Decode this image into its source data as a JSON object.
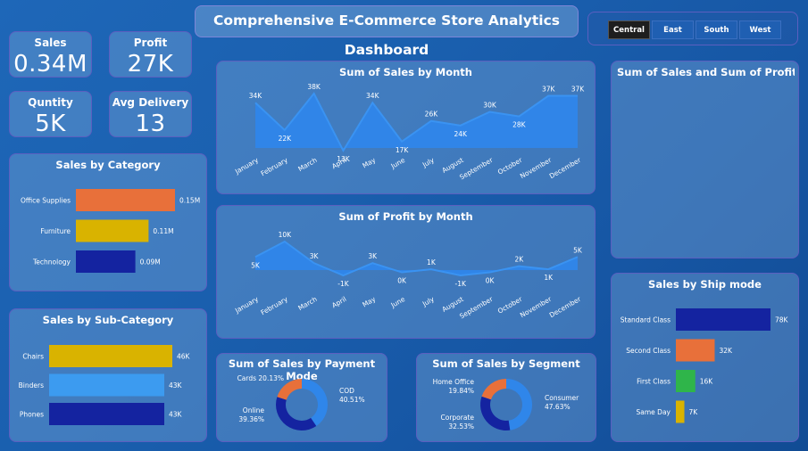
{
  "title": "Comprehensive E-Commerce Store Analytics Dashboard",
  "regions": [
    "Central",
    "East",
    "South",
    "West"
  ],
  "active_region": "Central",
  "kpis": {
    "sales": {
      "label": "Sales",
      "value": "0.34M"
    },
    "profit": {
      "label": "Profit",
      "value": "27K"
    },
    "quantity": {
      "label": "Quntity",
      "value": "5K"
    },
    "avg_delivery": {
      "label": "Avg Delivery",
      "value": "13"
    }
  },
  "panels": {
    "sales_by_category": "Sales by Category",
    "sales_by_subcategory": "Sales by Sub-Category",
    "sales_by_month": "Sum of Sales by Month",
    "profit_by_month": "Sum of Profit by Month",
    "payment_mode": "Sum of Sales by Payment Mode",
    "segment": "Sum of Sales by Segment",
    "sales_profit_by_state": "Sum of Sales and Sum of Profit by S...",
    "ship_mode": "Sales by Ship mode"
  },
  "colors": {
    "orange": "#e8703a",
    "gold": "#d9b300",
    "navy": "#1423a0",
    "lightblue": "#3c9bf0",
    "green": "#2fb54a",
    "area": "#2f86ea"
  },
  "chart_data": [
    {
      "id": "sales_by_month",
      "type": "area",
      "categories": [
        "January",
        "February",
        "March",
        "April",
        "May",
        "June",
        "July",
        "August",
        "September",
        "October",
        "November",
        "December"
      ],
      "values": [
        34,
        22,
        38,
        13,
        34,
        17,
        26,
        24,
        30,
        28,
        37,
        37
      ],
      "labels": [
        "34K",
        "22K",
        "38K",
        "13K",
        "34K",
        "17K",
        "26K",
        "24K",
        "30K",
        "28K",
        "37K",
        "37K"
      ]
    },
    {
      "id": "profit_by_month",
      "type": "area",
      "categories": [
        "January",
        "February",
        "March",
        "April",
        "May",
        "June",
        "July",
        "August",
        "September",
        "October",
        "November",
        "December"
      ],
      "values": [
        5,
        10,
        3,
        -1,
        3,
        0,
        1,
        -1,
        0,
        2,
        1,
        5
      ],
      "labels": [
        "5K",
        "10K",
        "3K",
        "-1K",
        "3K",
        "0K",
        "1K",
        "-1K",
        "0K",
        "2K",
        "1K",
        "5K"
      ]
    },
    {
      "id": "sales_by_category",
      "type": "bar",
      "categories": [
        "Office Supplies",
        "Furniture",
        "Technology"
      ],
      "values": [
        0.15,
        0.11,
        0.09
      ],
      "labels": [
        "0.15M",
        "0.11M",
        "0.09M"
      ],
      "colors": [
        "#e8703a",
        "#d9b300",
        "#1423a0"
      ]
    },
    {
      "id": "sales_by_subcategory",
      "type": "bar",
      "categories": [
        "Chairs",
        "Binders",
        "Phones"
      ],
      "values": [
        46,
        43,
        43
      ],
      "labels": [
        "46K",
        "43K",
        "43K"
      ],
      "colors": [
        "#d9b300",
        "#3c9bf0",
        "#1423a0"
      ]
    },
    {
      "id": "ship_mode",
      "type": "bar",
      "categories": [
        "Standard Class",
        "Second Class",
        "First Class",
        "Same Day"
      ],
      "values": [
        78,
        32,
        16,
        7
      ],
      "labels": [
        "78K",
        "32K",
        "16K",
        "7K"
      ],
      "colors": [
        "#1423a0",
        "#e8703a",
        "#2fb54a",
        "#d9b300"
      ]
    },
    {
      "id": "payment_mode",
      "type": "pie",
      "categories": [
        "COD",
        "Online",
        "Cards"
      ],
      "values": [
        40.51,
        39.36,
        20.13
      ],
      "labels": [
        "COD\n40.51%",
        "Online\n39.36%",
        "Cards 20.13%"
      ],
      "colors": [
        "#2f86ea",
        "#1423a0",
        "#e8703a"
      ]
    },
    {
      "id": "segment",
      "type": "pie",
      "categories": [
        "Consumer",
        "Corporate",
        "Home Office"
      ],
      "values": [
        47.63,
        32.53,
        19.84
      ],
      "labels": [
        "Consumer\n47.63%",
        "Corporate\n32.53%",
        "Home Office\n19.84%"
      ],
      "colors": [
        "#2f86ea",
        "#1423a0",
        "#e8703a"
      ]
    }
  ]
}
